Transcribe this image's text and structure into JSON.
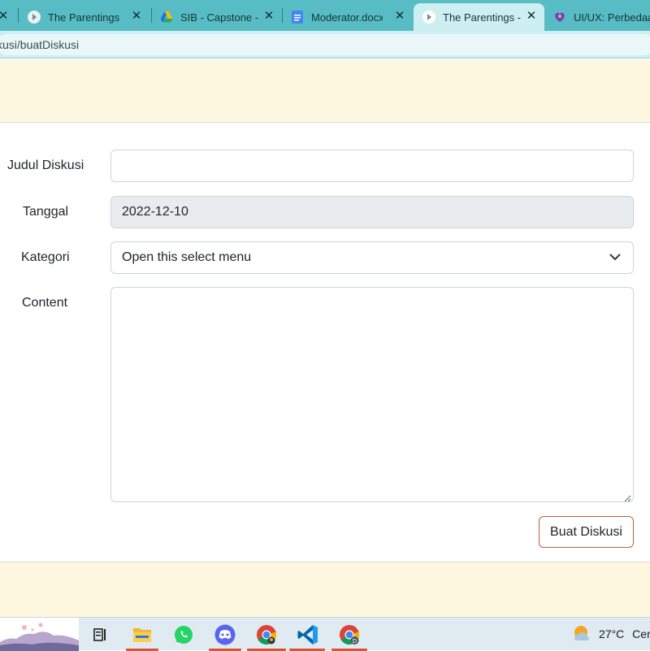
{
  "browser": {
    "tabs": [
      {
        "label": "The Parentings",
        "icon": "parentings-icon"
      },
      {
        "label": "SIB - Capstone -",
        "icon": "google-drive-icon"
      },
      {
        "label": "Moderator.docx",
        "icon": "google-docs-icon"
      },
      {
        "label": "The Parentings -",
        "icon": "parentings-icon",
        "active": true
      },
      {
        "label": "UI/UX: Perbedaa",
        "icon": "heart-flower-icon"
      }
    ],
    "url": "kusi/buatDiskusi"
  },
  "form": {
    "title_label": "Judul Diskusi",
    "title_value": "",
    "date_label": "Tanggal",
    "date_value": "2022-12-10",
    "category_label": "Kategori",
    "category_value": "Open this select menu",
    "content_label": "Content",
    "content_value": "",
    "submit_label": "Buat Diskusi"
  },
  "taskbar": {
    "apps": [
      "task-view-icon",
      "file-explorer-icon",
      "whatsapp-icon",
      "discord-icon",
      "chrome-icon",
      "vscode-icon",
      "chrome-profile-icon"
    ],
    "temperature": "27°C",
    "weather_text": "Cera"
  },
  "colors": {
    "tabstrip": "#58bcc4",
    "page_band": "#fff8e1",
    "button_border": "#c0603a"
  }
}
